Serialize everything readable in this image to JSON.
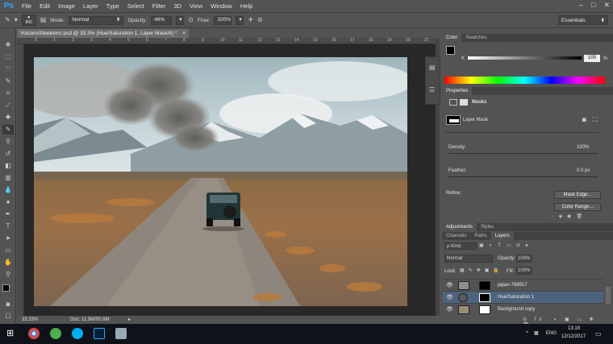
{
  "app": {
    "logo": "Ps"
  },
  "menubar": {
    "items": [
      "File",
      "Edit",
      "Image",
      "Layer",
      "Type",
      "Select",
      "Filter",
      "3D",
      "View",
      "Window",
      "Help"
    ]
  },
  "window_controls": {
    "minimize": "–",
    "maximize": "□",
    "close": "✕"
  },
  "options": {
    "brush_size": "800",
    "mode_label": "Mode:",
    "mode_value": "Normal",
    "opacity_label": "Opacity:",
    "opacity_value": "46%",
    "flow_label": "Flow:",
    "flow_value": "100%",
    "workspace": "Essentials"
  },
  "document": {
    "tab_title": "VolcanoSteekiens.psd @ 33.3% (Hue/Saturation 1, Layer Mask/8) *",
    "close": "×",
    "zoom": "33.33%",
    "doc_info": "Doc: 11.9M/50.9M"
  },
  "rulers": {
    "top": [
      "0",
      "1",
      "2",
      "3",
      "4",
      "5",
      "6",
      "7",
      "8",
      "9",
      "10",
      "11",
      "12",
      "13",
      "14",
      "15",
      "16",
      "17",
      "18",
      "19",
      "20",
      "21"
    ]
  },
  "color_panel": {
    "tabs": [
      "Color",
      "Swatches"
    ],
    "channel_label": "K",
    "channel_value": "100",
    "channel_unit": "%"
  },
  "properties_panel": {
    "tab": "Properties",
    "mode": "Masks",
    "mask_type": "Layer Mask",
    "density_label": "Density:",
    "density_value": "100%",
    "feather_label": "Feather:",
    "feather_value": "0.0 px",
    "refine_label": "Refine:",
    "mask_edge_button": "Mask Edge...",
    "color_range_button": "Color Range..."
  },
  "adjust_tabs": [
    "Adjustments",
    "Styles"
  ],
  "layers_panel": {
    "tabs": [
      "Channels",
      "Paths",
      "Layers"
    ],
    "kind_label": "ρ Kind",
    "blend_mode": "Normal",
    "opacity_label": "Opacity:",
    "opacity_value": "100%",
    "lock_label": "Lock:",
    "fill_label": "Fill:",
    "fill_value": "100%",
    "layers": [
      {
        "name": "japan-768917"
      },
      {
        "name": "Hue/Saturation 1"
      },
      {
        "name": "Background copy"
      }
    ],
    "footer_icons": "⊖ fx. ◐ ▣ ▭ ✚ 🗑"
  },
  "taskbar": {
    "tray_arrow": "^",
    "language": "ENG",
    "time": "13:19",
    "date": "12/12/2017"
  },
  "colors": {
    "ps_blue": "#31a8ff",
    "selected_layer": "#4d637d",
    "taskbar": "#0f1319"
  }
}
